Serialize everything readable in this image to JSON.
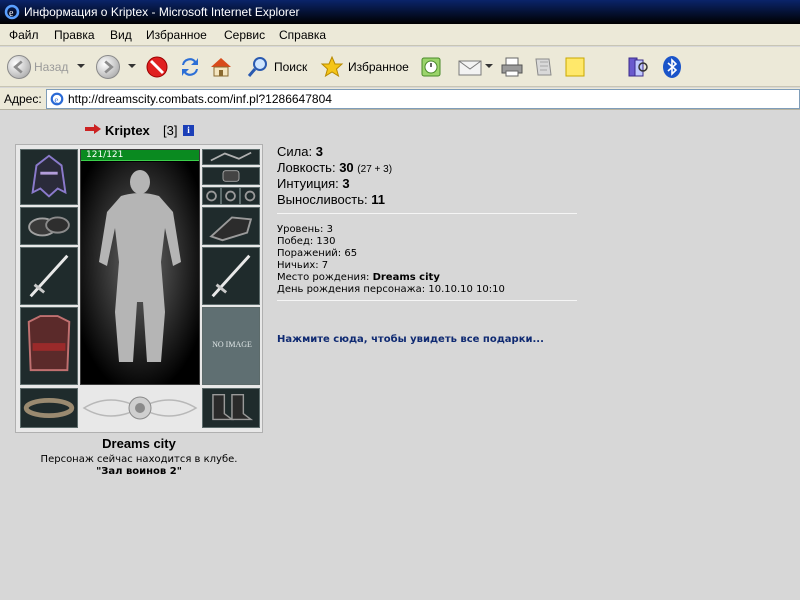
{
  "window": {
    "title": "Информация о Kriptex - Microsoft Internet Explorer"
  },
  "menu": [
    "Файл",
    "Правка",
    "Вид",
    "Избранное",
    "Сервис",
    "Справка"
  ],
  "toolbar": {
    "back_label": "Назад",
    "search_label": "Поиск",
    "favorites_label": "Избранное"
  },
  "address": {
    "label": "Адрес:",
    "url": "http://dreamscity.combats.com/inf.pl?1286647804"
  },
  "character": {
    "name": "Kriptex",
    "level": "[3]",
    "hp": "121/121",
    "hp_fraction": 1.0,
    "no_image": "NO IMAGE"
  },
  "stats": [
    {
      "label": "Сила:",
      "value": "3",
      "extra": ""
    },
    {
      "label": "Ловкость:",
      "value": "30",
      "extra": "(27 + 3)"
    },
    {
      "label": "Интуиция:",
      "value": "3",
      "extra": ""
    },
    {
      "label": "Выносливость:",
      "value": "11",
      "extra": ""
    }
  ],
  "info": {
    "level": "Уровень: 3",
    "wins": "Побед: 130",
    "losses": "Поражений: 65",
    "draws": "Ничьих: 7",
    "birthplace_label": "Место рождения:",
    "birthplace_value": "Dreams city",
    "birthday": "День рождения персонажа: 10.10.10 10:10"
  },
  "gifts_link": "Нажмите сюда, чтобы увидеть все подарки...",
  "location": {
    "city": "Dreams city",
    "status": "Персонаж сейчас находится в клубе.",
    "room": "\"Зал воинов 2\""
  },
  "colors": {
    "hp_bar": "#0a8a20",
    "link": "#0f2a72",
    "content_bg": "#d7d7d7"
  }
}
